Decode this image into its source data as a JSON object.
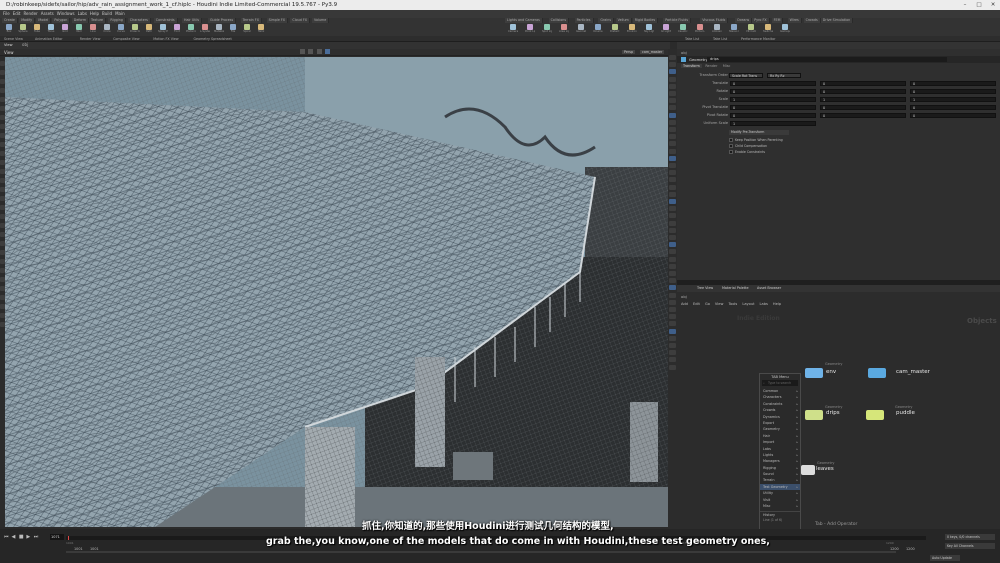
{
  "window": {
    "title": "D:/robinkeep/sidefx/sailor/hip/adv_rain_assignment_work_1_cf.hiplc - Houdini Indie Limited-Commercial 19.5.767 - Py3.9",
    "min_icon": "minimize-icon",
    "max_icon": "maximize-icon",
    "close_icon": "close-icon"
  },
  "menu": [
    "File",
    "Edit",
    "Render",
    "Assets",
    "Windows",
    "Labs",
    "Help",
    "Build",
    "Main"
  ],
  "shelf": {
    "left_tabs": [
      "Create",
      "Modify",
      "Model",
      "Polygon",
      "Deform",
      "Texture",
      "Rigging",
      "Characters",
      "Constraints",
      "Hair Utils",
      "Guide Process",
      "Terrain FX",
      "Simple FX",
      "Cloud FX",
      "Volume"
    ],
    "right_tabs": [
      "Lights and Cameras",
      "Collisions",
      "Particles",
      "Grains",
      "Vellum",
      "Rigid Bodies",
      "Particle Fluids",
      "Viscous Fluids",
      "Oceans",
      "Pyro FX",
      "FEM",
      "Wires",
      "Crowds",
      "Drive Simulation"
    ],
    "left_tools": [
      "Box",
      "Sphere",
      "Tube",
      "Torus",
      "Grid",
      "Null",
      "Line",
      "Circle",
      "Curve",
      "Draw Curve",
      "Path",
      "Spray Paint",
      "Font",
      "Platonic",
      "L-System",
      "Metaball",
      "File",
      "Spiral",
      "Helix"
    ],
    "right_tools": [
      "Camera",
      "Point Light",
      "Spot Light",
      "Area Light",
      "Geometry Light",
      "Volume Light",
      "Distant Light",
      "Environment",
      "Sky Light",
      "GI Light",
      "Caustic Light",
      "Portal Light",
      "Ambient Light",
      "Stereo Camera",
      "VR Camera",
      "Switcher",
      "Gamepad Camera"
    ]
  },
  "desktop_tabs": [
    "Scene View",
    "Animation Editor",
    "Render View",
    "Composite View",
    "Motion FX View",
    "Geometry Spreadsheet"
  ],
  "right_desktop_tabs": [
    "Take List",
    "Take List",
    "Performance Monitor"
  ],
  "viewport": {
    "tab": "View",
    "path": "obj",
    "persp": "Persp",
    "cam": "cam_master",
    "mode_label": "No cam"
  },
  "params": {
    "header": "Geometry",
    "node": "drips",
    "tabs": [
      "Transform",
      "Render",
      "Misc"
    ],
    "rows": [
      {
        "label": "Transform Order",
        "v1": "Scale Rot Trans",
        "v2": "Rx Ry Rz"
      },
      {
        "label": "Translate",
        "v1": "0",
        "v2": "0",
        "v3": "0"
      },
      {
        "label": "Rotate",
        "v1": "0",
        "v2": "0",
        "v3": "0"
      },
      {
        "label": "Scale",
        "v1": "1",
        "v2": "1",
        "v3": "1"
      },
      {
        "label": "Pivot Translate",
        "v1": "0",
        "v2": "0",
        "v3": "0"
      },
      {
        "label": "Pivot Rotate",
        "v1": "0",
        "v2": "0",
        "v3": "0"
      },
      {
        "label": "Uniform Scale",
        "v1": "1"
      }
    ],
    "modify_label": "Modify Pre-Transform",
    "checks": [
      "Keep Position When Parenting",
      "Child Compensation",
      "Enable Constraints"
    ]
  },
  "network": {
    "tabs": [
      "Tree View",
      "Material Palette",
      "Asset Browser"
    ],
    "path": "obj",
    "menu": [
      "Add",
      "Edit",
      "Go",
      "View",
      "Tools",
      "Layout",
      "Labs",
      "Help"
    ],
    "context": "Objects",
    "watermark": "Indie Edition",
    "nodes": [
      {
        "name": "env",
        "type": "Geometry",
        "color": "#6fb3e8"
      },
      {
        "name": "cam_master",
        "type": "",
        "color": "#5aa9e0"
      },
      {
        "name": "drips",
        "type": "Geometry",
        "color": "#cfe08a"
      },
      {
        "name": "puddle",
        "type": "Geometry",
        "color": "#d6e67a"
      },
      {
        "name": "leaves",
        "type": "Geometry",
        "color": "#dddddd"
      }
    ],
    "footer": "Tab - Add Operator"
  },
  "tab_menu": {
    "title": "TAB Menu",
    "search_placeholder": "Type to search",
    "items": [
      "Common",
      "Characters",
      "Constraints",
      "Crowds",
      "Dynamics",
      "Export",
      "Geometry",
      "Hair",
      "Import",
      "Labs",
      "Lights",
      "Managers",
      "Rigging",
      "Sound",
      "Terrain",
      "Test Geometry",
      "Utility",
      "Visit",
      "Misc"
    ],
    "highlighted_index": 15,
    "history_label": "History",
    "footer": "Line (1 of 6)"
  },
  "timeline": {
    "frame": "1071",
    "start": "1001",
    "end": "1001",
    "range_end": "1200",
    "range_end2": "1200",
    "frame_field": "1001",
    "ticks": [
      "1001",
      "1050",
      "1100",
      "1150",
      "1200"
    ],
    "keys_label": "0 keys, 0/0 channels",
    "key_all_label": "Key All Channels",
    "auto_update": "Auto Update"
  },
  "subtitles": {
    "zh": "抓住,你知道的,那些使用Houdini进行测试几何结构的模型,",
    "en": "grab the,you know,one of the models that do come in with Houdini,these test geometry ones,"
  }
}
